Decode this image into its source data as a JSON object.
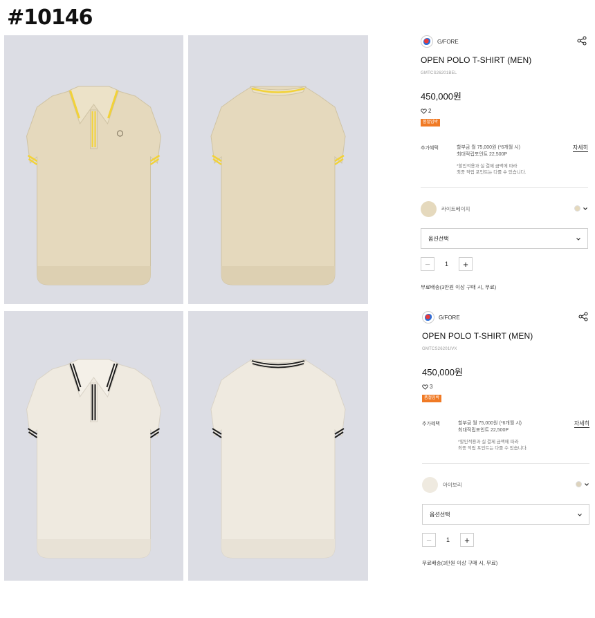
{
  "page_id": "#10146",
  "colors": {
    "photo_bg": "#dcdde4",
    "badge_bg": "#f07a25",
    "beige": "#e5d9bd",
    "ivory": "#efeae0",
    "yellow_trim": "#f2d238",
    "black_trim": "#1b1b1b"
  },
  "photos": [
    {
      "name": "beige-polo-front",
      "icon": "polo-shirt-front"
    },
    {
      "name": "beige-polo-back",
      "icon": "polo-shirt-back"
    },
    {
      "name": "ivory-polo-front",
      "icon": "polo-shirt-front"
    },
    {
      "name": "ivory-polo-back",
      "icon": "polo-shirt-back"
    }
  ],
  "products": [
    {
      "brand": "G/FORE",
      "title": "OPEN POLO T-SHIRT (MEN)",
      "code": "GMTCS26201BEL",
      "price": "450,000원",
      "likes": "2",
      "badge": "품절임박",
      "benefit_label": "추가혜택",
      "benefit_line1": "할부금 월 75,000원 (*6개월 시)",
      "benefit_line2": "최대적립포인트 22,500P",
      "benefit_note1": "*할인적용과 실 결제 금액에 따라",
      "benefit_note2": "최종 적립 포인트는 다를 수 있습니다.",
      "detail_link": "자세히",
      "color_name": "라이트베이지",
      "color_hex": "#e5d9bd",
      "option_placeholder": "옵션선택",
      "quantity": "1",
      "minus": "−",
      "plus": "+",
      "shipping": "무료배송(3만원 이상 구매 시, 무료)"
    },
    {
      "brand": "G/FORE",
      "title": "OPEN POLO T-SHIRT (MEN)",
      "code": "GMTCS26201IVX",
      "price": "450,000원",
      "likes": "3",
      "badge": "품절임박",
      "benefit_label": "추가혜택",
      "benefit_line1": "할부금 월 75,000원 (*6개월 시)",
      "benefit_line2": "최대적립포인트 22,500P",
      "benefit_note1": "*할인적용과 실 결제 금액에 따라",
      "benefit_note2": "최종 적립 포인트는 다를 수 있습니다.",
      "detail_link": "자세히",
      "color_name": "아이보리",
      "color_hex": "#efeae0",
      "option_placeholder": "옵션선택",
      "quantity": "1",
      "minus": "−",
      "plus": "+",
      "shipping": "무료배송(3만원 이상 구매 시, 무료)"
    }
  ]
}
